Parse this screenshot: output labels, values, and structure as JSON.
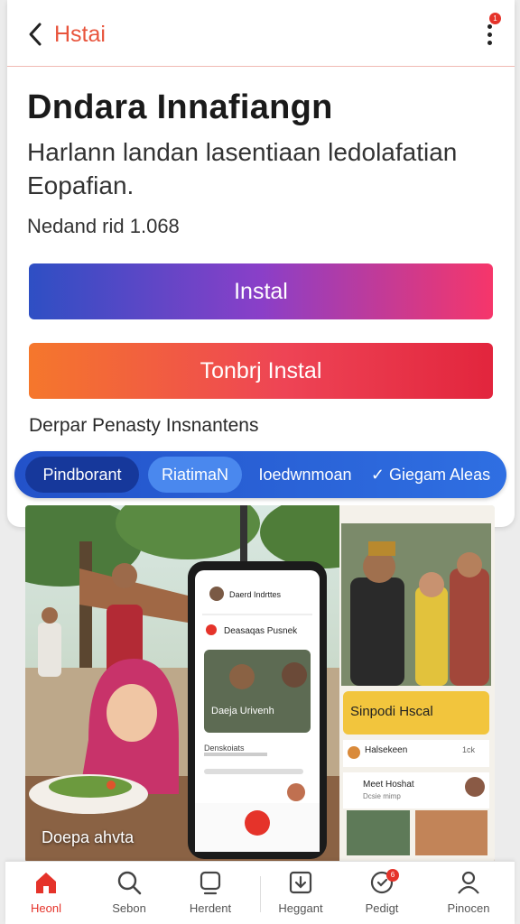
{
  "header": {
    "title": "Hstai",
    "notification_count": "1"
  },
  "app": {
    "title": "Dndara Innafiangn",
    "description": "Harlann landan lasentiaan ledolafatian Eopafian.",
    "downloads": "Nedand rid 1.068"
  },
  "buttons": {
    "install": "Instal",
    "secondary_install": "Tonbrj Instal"
  },
  "hint": "Derpar Penasty Insnantens",
  "chips": [
    "Pindborant",
    "RiatimaN",
    "Ioedwnmoan",
    "Giegam Aleas"
  ],
  "screenshot": {
    "photo_caption": "Doepa ahvta",
    "phone_app_title": "Daerd Indrttes",
    "phone_header": "Deasaqas Pusnek",
    "phone_card": "Daeja Urivenh",
    "phone_row": "Denskoiats",
    "panel_banner": "Sinpodi Hscal",
    "panel_row1": "Halsekeen",
    "panel_row1_count": "1ck",
    "panel_row2": "Meet Hoshat",
    "panel_row2_sub": "Dcsie mimp"
  },
  "bottom_nav": [
    {
      "label": "Heonl",
      "icon": "home-icon",
      "active": true
    },
    {
      "label": "Sebon",
      "icon": "search-icon",
      "active": false
    },
    {
      "label": "Herdent",
      "icon": "profile-card-icon",
      "active": false
    },
    {
      "label": "Heggant",
      "icon": "download-icon",
      "active": false
    },
    {
      "label": "Pedigt",
      "icon": "notification-icon",
      "active": false,
      "badge": "6"
    },
    {
      "label": "Pinocen",
      "icon": "user-icon",
      "active": false
    }
  ],
  "colors": {
    "accent": "#e5332a",
    "chip_bar": "#2352c9",
    "install_start": "#2e4fc4",
    "install_end": "#f6366a"
  }
}
